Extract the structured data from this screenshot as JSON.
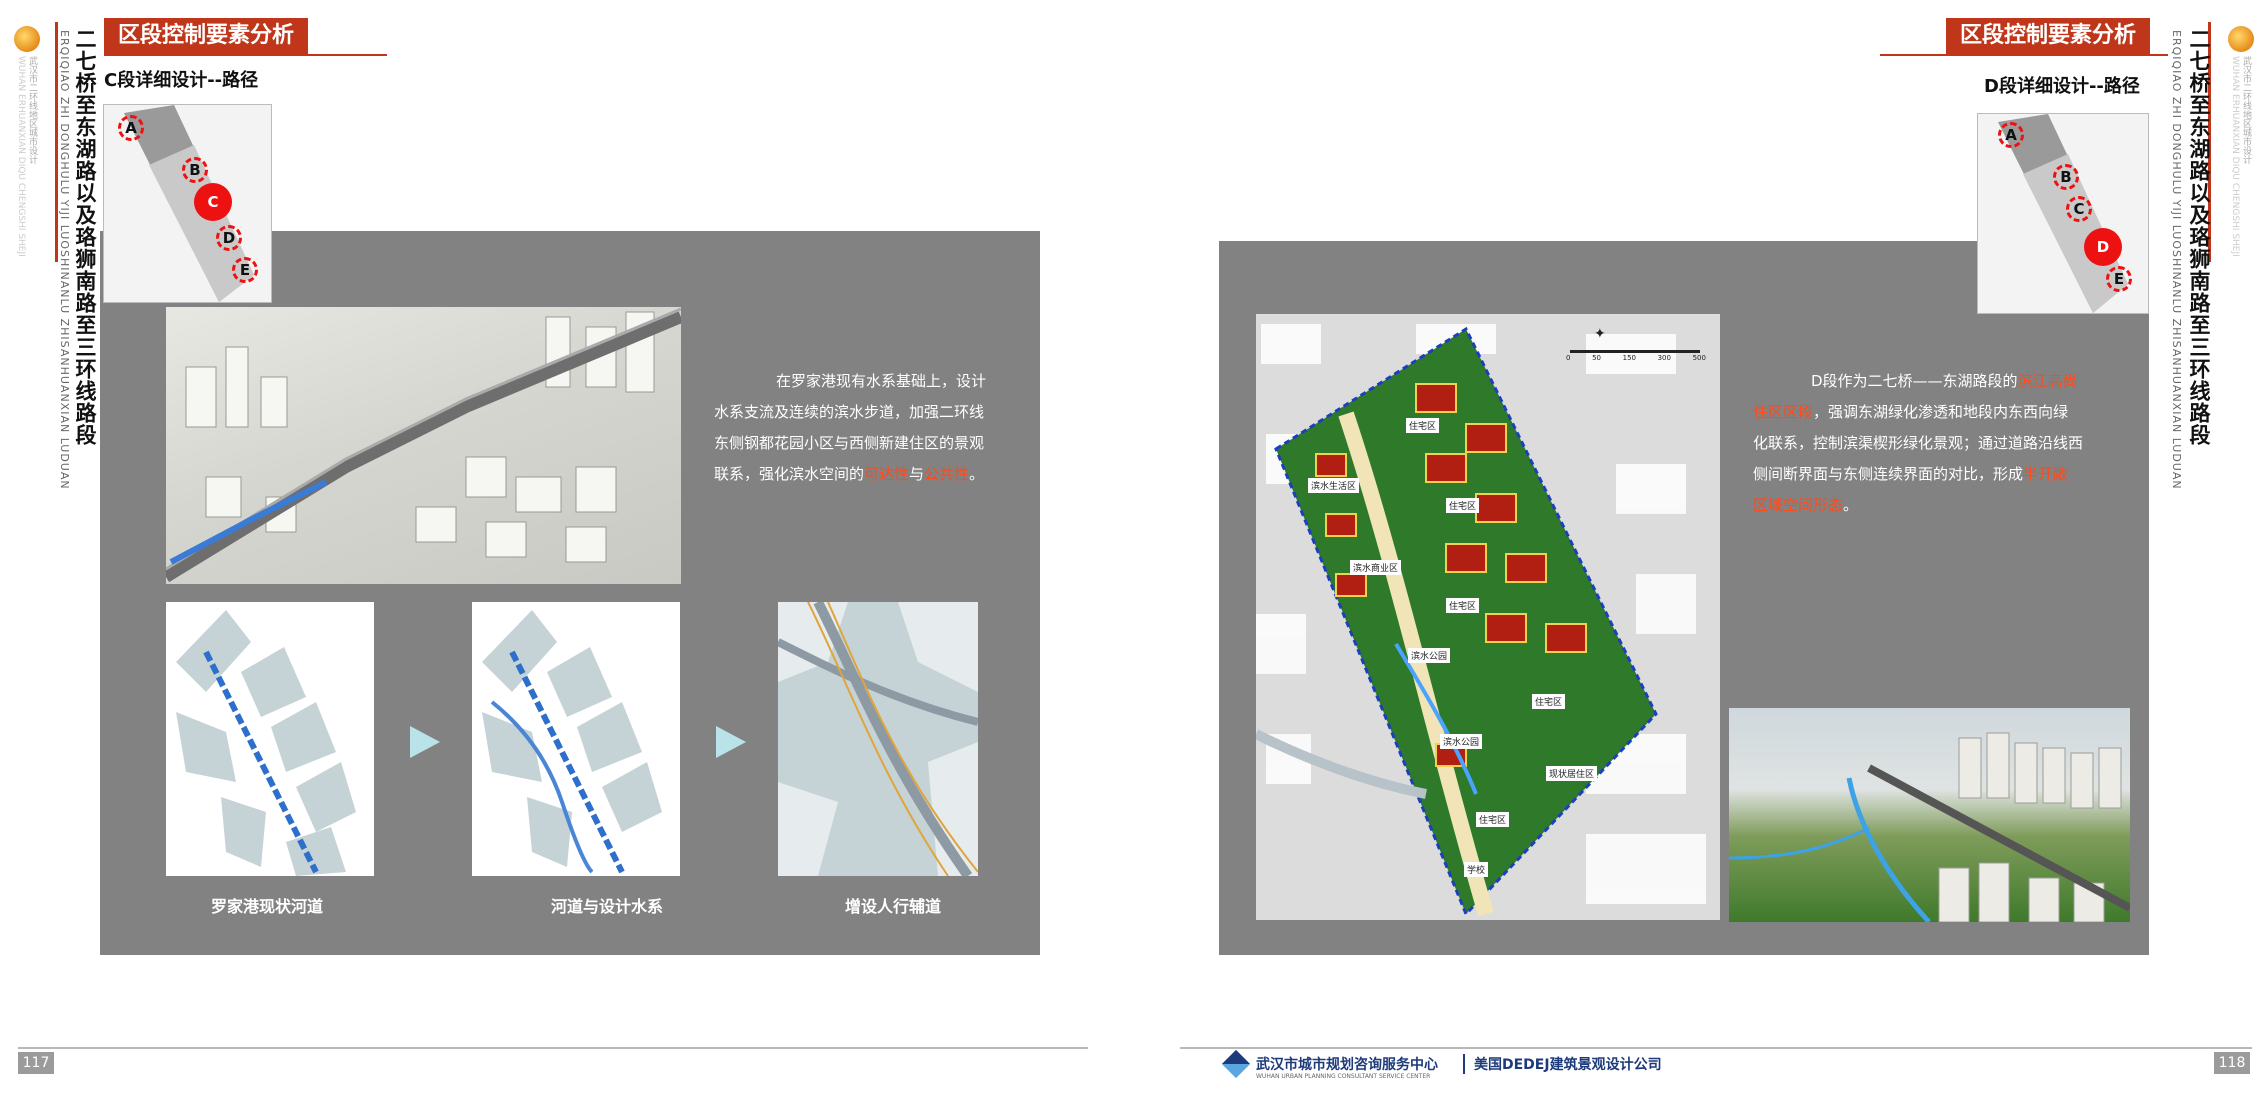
{
  "left_page": {
    "header": "区段控制要素分析",
    "section_title": "C段详细设计--路径",
    "side_title": "二七桥至东湖路以及珞狮南路至三环线路段",
    "side_pinyin": "ERQIQIAO ZHI DONGHULU YIJI LUOSHINANLU ZHISANHUANXIAN LUDUAN",
    "side_org": "武汉市二环线地区城市设计",
    "keymap_labels": [
      "A",
      "B",
      "C",
      "D",
      "E"
    ],
    "keymap_active": "C",
    "paragraph": {
      "text": "在罗家港现有水系基础上，设计水系支流及连续的滨水步道，加强二环线东侧钢都花园小区与西侧新建住区的景观联系，强化滨水空间的",
      "hl1": "可达性",
      "mid": "与",
      "hl2": "公共性",
      "end": "。"
    },
    "captions": [
      "罗家港现状河道",
      "河道与设计水系",
      "增设人行辅道"
    ],
    "page_number": "117"
  },
  "right_page": {
    "header": "区段控制要素分析",
    "section_title": "D段详细设计--路径",
    "side_title": "二七桥至东湖路以及珞狮南路至三环线路段",
    "side_pinyin": "ERQIQIAO ZHI DONGHULU YIJI LUOSHINANLU ZHISANHUANXIAN LUDUAN",
    "side_org": "武汉市二环线地区城市设计",
    "keymap_labels": [
      "A",
      "B",
      "C",
      "D",
      "E"
    ],
    "keymap_active": "D",
    "paragraph": {
      "start": "D段作为二七桥——东湖路段的",
      "hl1": "滨江高尚住区区段",
      "mid": "，强调东湖绿化渗透和地段内东西向绿化联系，控制滨渠楔形绿化景观；通过道路沿线西侧间断界面与东侧连续界面的对比，形成",
      "hl2": "半开敞区域空间形态",
      "end": "。"
    },
    "plan_labels": [
      "住宅区",
      "滨水生活区",
      "住宅区",
      "滨水商业区",
      "住宅区",
      "滨水公园",
      "住宅区",
      "滨水公园",
      "现状居住区",
      "住宅区",
      "学校"
    ],
    "scale_labels": [
      "0",
      "50",
      "150",
      "300",
      "500"
    ],
    "page_number": "118",
    "footer_org1": "武汉市城市规划咨询服务中心",
    "footer_org1_en": "WUHAN URBAN PLANNING CONSULTANT SERVICE CENTER",
    "footer_org2": "美国DEDEJ建筑景观设计公司"
  },
  "colors": {
    "accent": "#c0361a",
    "panel": "#828282",
    "highlight": "#ff4a1a",
    "marker": "#ee1111"
  }
}
